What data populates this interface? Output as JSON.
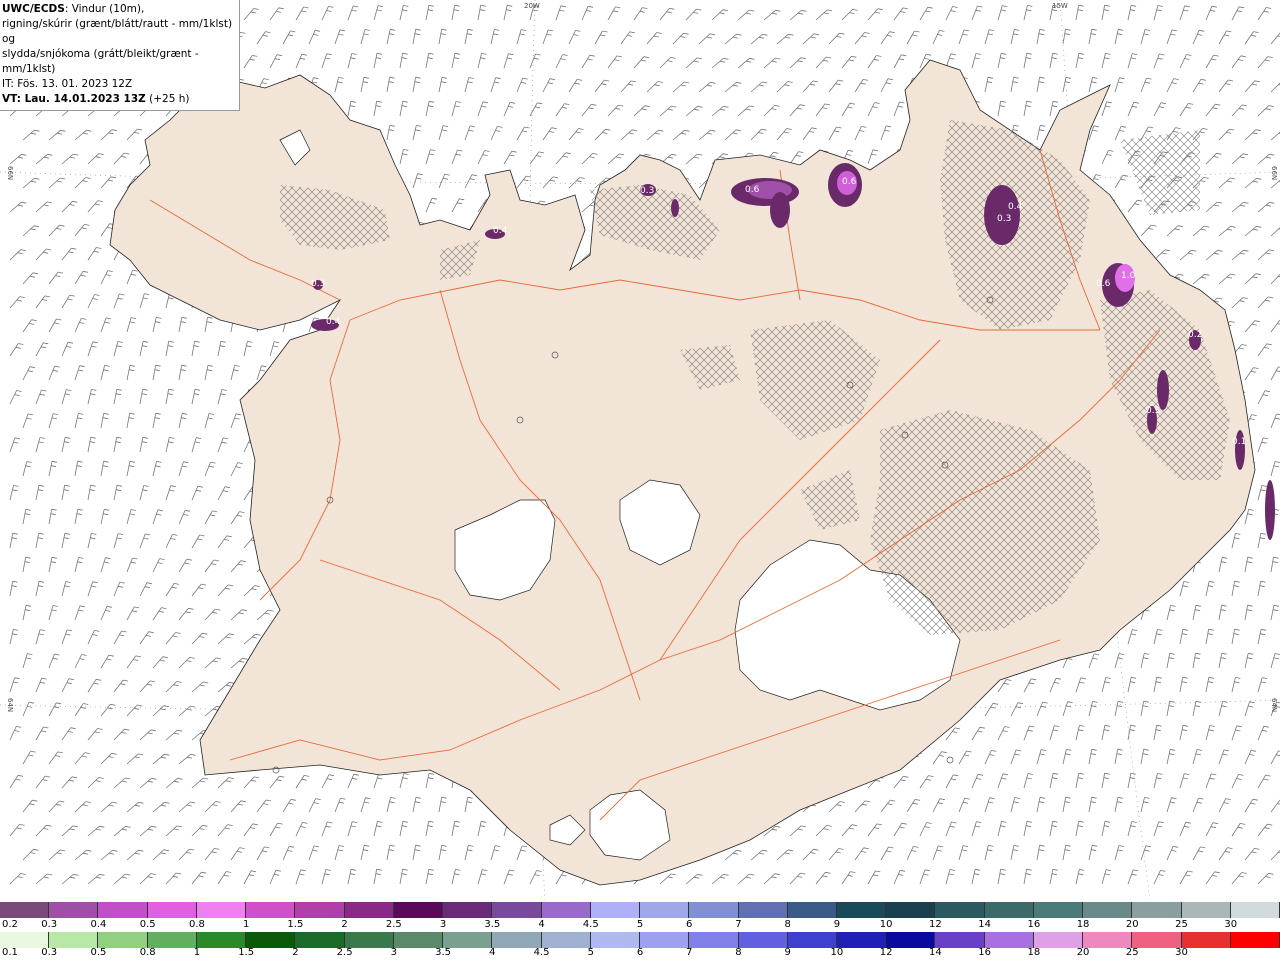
{
  "header": {
    "title_prefix": "UWC/ECDS",
    "title_rest": ": Vindur (10m),",
    "line2": "rigning/skúrir (grænt/blátt/rautt - mm/1klst) og",
    "line3": "slydda/snjókoma (grátt/bleikt/grænt - mm/1klst)",
    "issue_time": "IT: Fös. 13. 01. 2023 12Z",
    "valid_prefix": "VT: Lau. 14.01.2023 13Z",
    "valid_suffix": " (+25 h)"
  },
  "grid_labels": {
    "lon_20w": "20W",
    "lon_15w": "15W",
    "lat_66n_left": "66N",
    "lat_66n_right": "66N",
    "lat_64n_left": "64N",
    "lat_64n_right": "64N"
  },
  "precip_labels": [
    "0.3",
    "0.6",
    "0.6",
    "0.4",
    "0.3",
    "1.0",
    "0.6",
    "0.4",
    "0.3",
    "0.1",
    "0.2",
    "0.3",
    "0.4"
  ],
  "colorbar_top": {
    "labels": [
      "0.2",
      "0.3",
      "0.4",
      "0.5",
      "0.8",
      "1",
      "1.5",
      "2",
      "2.5",
      "3",
      "3.5",
      "4",
      "4.5",
      "5",
      "6",
      "7",
      "8",
      "9",
      "10",
      "12",
      "14",
      "16",
      "18",
      "20",
      "25",
      "30"
    ],
    "colors": [
      "#7a4a7a",
      "#9e4fa6",
      "#c04fc8",
      "#e060e0",
      "#f080f0",
      "#d050c8",
      "#b040a8",
      "#8a2a88",
      "#5a0a5a",
      "#6a2a7a",
      "#7a4a9a",
      "#9a6ac8",
      "#b0b0f8",
      "#a0a8e8",
      "#8090d0",
      "#6070b0",
      "#3a5a8a",
      "#1a4a5a",
      "#1a4050",
      "#2a5a60",
      "#3a6a6a",
      "#4a7a7a",
      "#6a8a8a",
      "#8aa0a0",
      "#a8b8b8",
      "#d0dada"
    ]
  },
  "colorbar_bottom": {
    "labels": [
      "0.1",
      "0.3",
      "0.5",
      "0.8",
      "1",
      "1.5",
      "2",
      "2.5",
      "3",
      "3.5",
      "4",
      "4.5",
      "5",
      "6",
      "7",
      "8",
      "9",
      "10",
      "12",
      "14",
      "16",
      "18",
      "20",
      "25",
      "30"
    ],
    "colors": [
      "#e8f8e0",
      "#b8e8a8",
      "#90d080",
      "#60b060",
      "#2a8a2a",
      "#0a5a0a",
      "#1a6a2a",
      "#3a7a4a",
      "#5a8a6a",
      "#7aa090",
      "#90a8b8",
      "#a0b0d0",
      "#b0b8f0",
      "#a0a0f0",
      "#8080e8",
      "#6060e0",
      "#4040d0",
      "#2020b8",
      "#0a0aa0",
      "#6a40c8",
      "#a870e0",
      "#e0a0e8",
      "#f088c0",
      "#f06080",
      "#e83030",
      "#ff0000"
    ]
  }
}
